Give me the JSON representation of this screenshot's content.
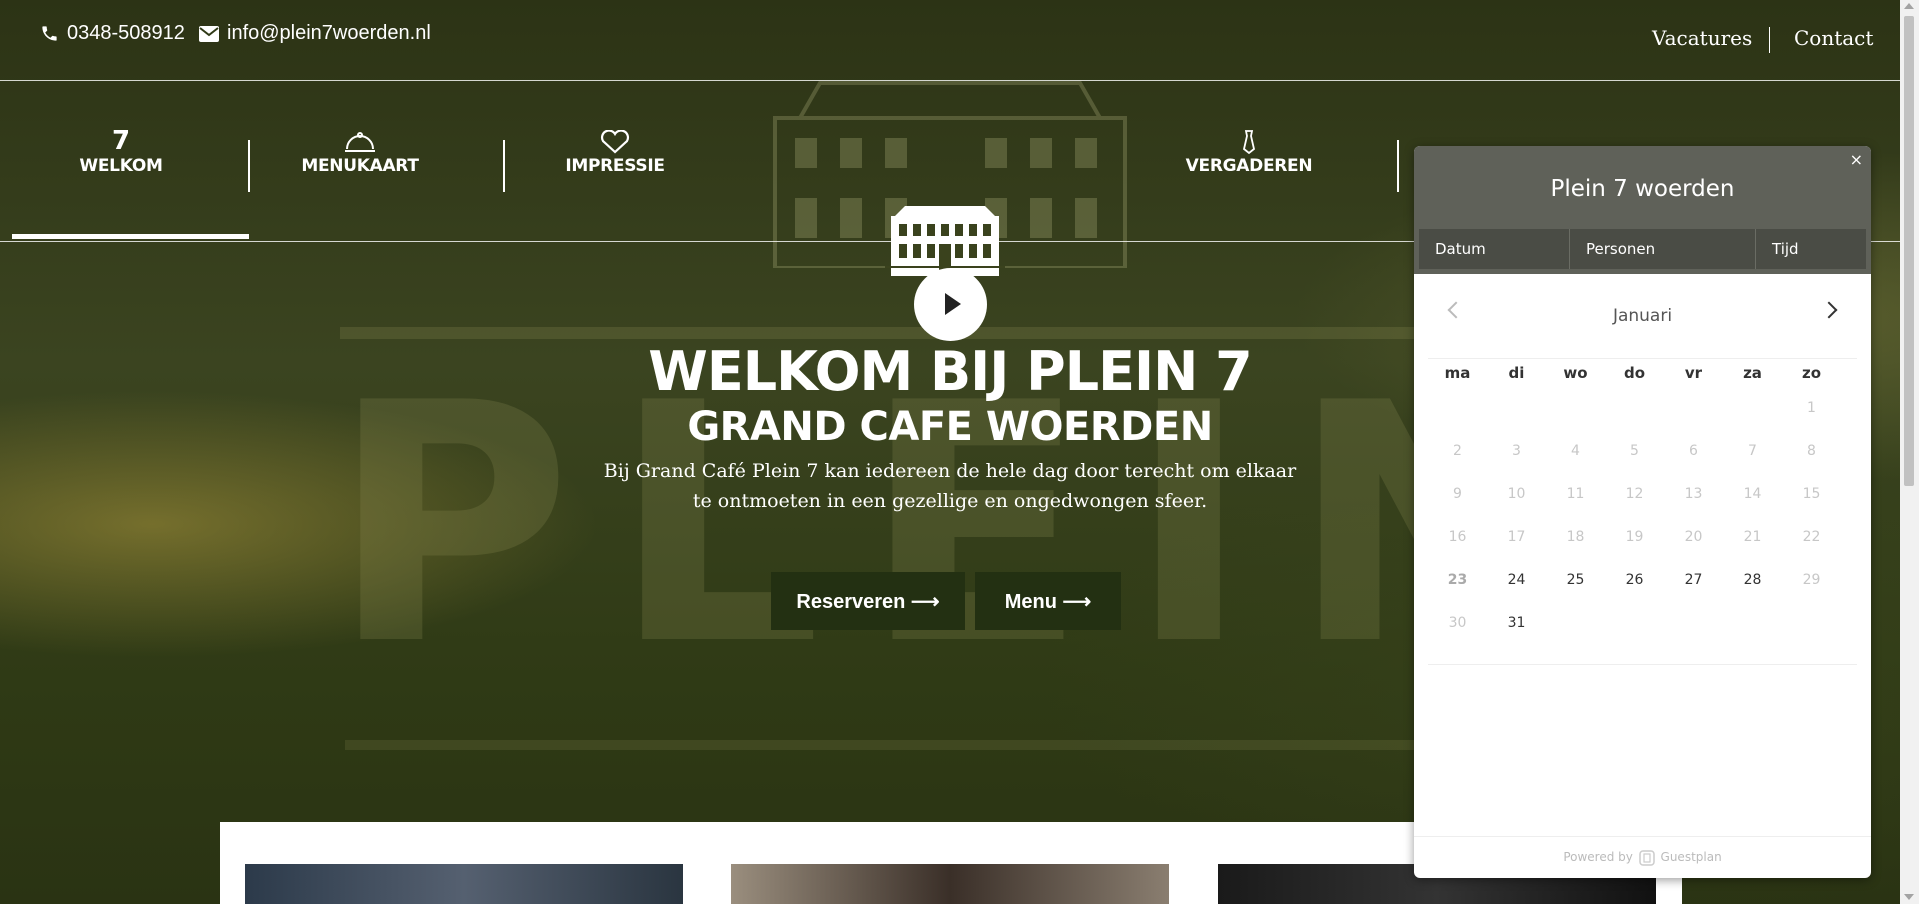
{
  "topbar": {
    "phone": "0348-508912",
    "email": "info@plein7woerden.nl",
    "links": [
      "Vacatures",
      "Contact"
    ]
  },
  "nav": {
    "items": [
      {
        "label": "WELKOM",
        "icon": "seven-numeral-icon",
        "icon_text": "7",
        "active": true
      },
      {
        "label": "MENUKAART",
        "icon": "cloche-icon"
      },
      {
        "label": "IMPRESSIE",
        "icon": "heart-icon"
      },
      {
        "label": "VERGADEREN",
        "icon": "tie-icon"
      }
    ]
  },
  "hero": {
    "title": "WELKOM BIJ PLEIN 7",
    "subtitle": "GRAND CAFE WOERDEN",
    "lead": "Bij Grand Café Plein 7 kan iedereen de hele dag door terecht om elkaar te ontmoeten in een gezellige en ongedwongen sfeer.",
    "buttons": [
      "Reserveren ⟶",
      "Menu ⟶"
    ]
  },
  "widget": {
    "title": "Plein 7 woerden",
    "close": "×",
    "tabs": [
      "Datum",
      "Personen",
      "Tijd"
    ],
    "month": "Januari",
    "weekdays": [
      "ma",
      "di",
      "wo",
      "do",
      "vr",
      "za",
      "zo"
    ],
    "weeks": [
      [
        "",
        "",
        "",
        "",
        "",
        "",
        "1"
      ],
      [
        "2",
        "3",
        "4",
        "5",
        "6",
        "7",
        "8"
      ],
      [
        "9",
        "10",
        "11",
        "12",
        "13",
        "14",
        "15"
      ],
      [
        "16",
        "17",
        "18",
        "19",
        "20",
        "21",
        "22"
      ],
      [
        "23",
        "24",
        "25",
        "26",
        "27",
        "28",
        "29"
      ],
      [
        "30",
        "31",
        "",
        "",
        "",
        "",
        ""
      ]
    ],
    "enabled_days": [
      "24",
      "25",
      "26",
      "27",
      "28",
      "31"
    ],
    "today": "23",
    "footer_powered": "Powered by",
    "footer_brand": "Guestplan"
  },
  "colors": {
    "button_bg": "#233012",
    "widget_header": "#5f6159",
    "hero_overlay": "#303a17"
  }
}
